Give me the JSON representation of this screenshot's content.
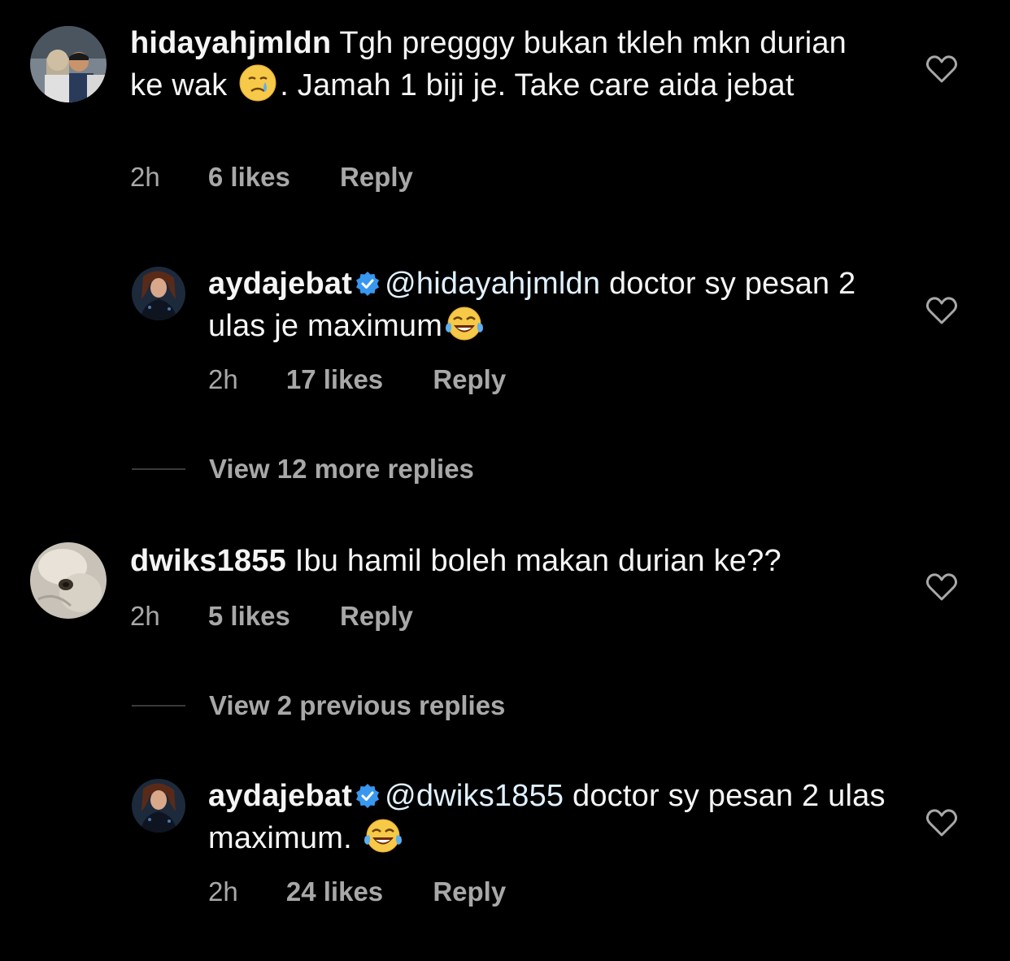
{
  "comments": [
    {
      "username": "hidayahjmldn",
      "text_1": "Tgh pregggy bukan tkleh mkn durian ke wak",
      "emoji_1": "crying-face",
      "text_2": ". Jamah 1 biji je. Take care aida jebat",
      "time": "2h",
      "likes": "6 likes",
      "reply": "Reply"
    },
    {
      "username": "aydajebat",
      "verified": true,
      "mention": "@hidayahjmldn",
      "text_1": "doctor sy pesan 2 ulas je maximum",
      "emoji_1": "tears-of-joy",
      "time": "2h",
      "likes": "17 likes",
      "reply": "Reply"
    },
    {
      "view_more": "View 12 more replies"
    },
    {
      "username": "dwiks1855",
      "text_1": "Ibu hamil boleh makan durian ke??",
      "time": "2h",
      "likes": "5 likes",
      "reply": "Reply"
    },
    {
      "view_more": "View 2 previous replies"
    },
    {
      "username": "aydajebat",
      "verified": true,
      "mention": "@dwiks1855",
      "text_1": "doctor sy pesan 2 ulas maximum.",
      "emoji_1": "tears-of-joy",
      "time": "2h",
      "likes": "24 likes",
      "reply": "Reply"
    }
  ],
  "colors": {
    "background": "#000000",
    "text": "#f5f5f5",
    "meta": "#a8a8a8",
    "mention": "#e0f1ff",
    "verified": "#3897f0"
  }
}
